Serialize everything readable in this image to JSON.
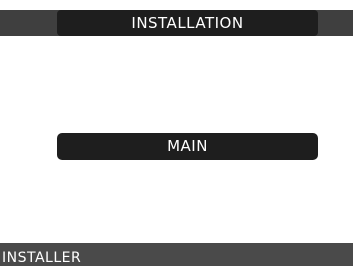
{
  "header": {
    "title": "INSTALLATION"
  },
  "menu": {
    "main_label": "MAIN"
  },
  "footer": {
    "label": "INSTALLER"
  },
  "colors": {
    "pill": "#1e1e1e",
    "strip": "#3f3f3f",
    "footer": "#4a4a4a",
    "background": "#ffffff",
    "text": "#ffffff"
  }
}
